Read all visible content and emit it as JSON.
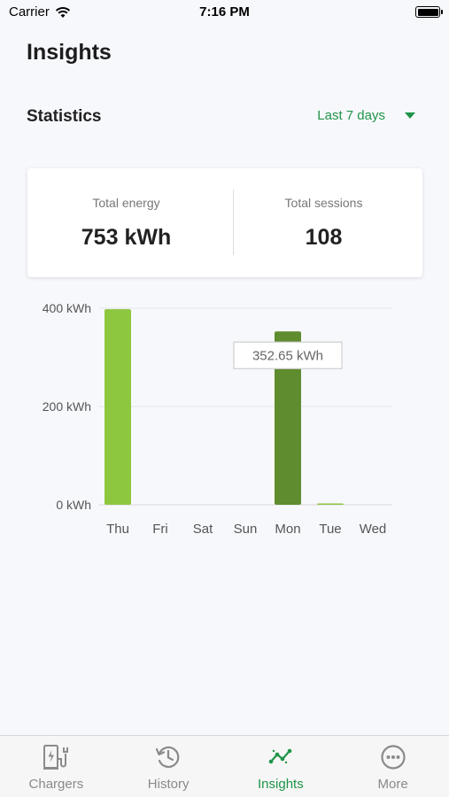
{
  "status_bar": {
    "carrier": "Carrier",
    "time": "7:16 PM"
  },
  "page_title": "Insights",
  "statistics": {
    "title": "Statistics",
    "range": "Last 7 days"
  },
  "summary": {
    "total_energy_label": "Total energy",
    "total_energy_value": "753 kWh",
    "total_sessions_label": "Total sessions",
    "total_sessions_value": "108"
  },
  "tooltip": "352.65 kWh",
  "colors": {
    "accent": "#1f9448",
    "bar": "#8dc63f",
    "bar_selected": "#5e8c2e"
  },
  "chart_data": {
    "type": "bar",
    "categories": [
      "Thu",
      "Fri",
      "Sat",
      "Sun",
      "Mon",
      "Tue",
      "Wed"
    ],
    "values": [
      398,
      0,
      0,
      0,
      352.65,
      2,
      0
    ],
    "selected_index": 4,
    "unit": "kWh",
    "ylim": [
      0,
      400
    ],
    "yticks": [
      "0 kWh",
      "200 kWh",
      "400 kWh"
    ],
    "ytick_values": [
      0,
      200,
      400
    ],
    "grid": true
  },
  "tabs": [
    {
      "label": "Chargers",
      "icon": "charger-icon",
      "active": false
    },
    {
      "label": "History",
      "icon": "history-icon",
      "active": false
    },
    {
      "label": "Insights",
      "icon": "insights-icon",
      "active": true
    },
    {
      "label": "More",
      "icon": "more-icon",
      "active": false
    }
  ]
}
